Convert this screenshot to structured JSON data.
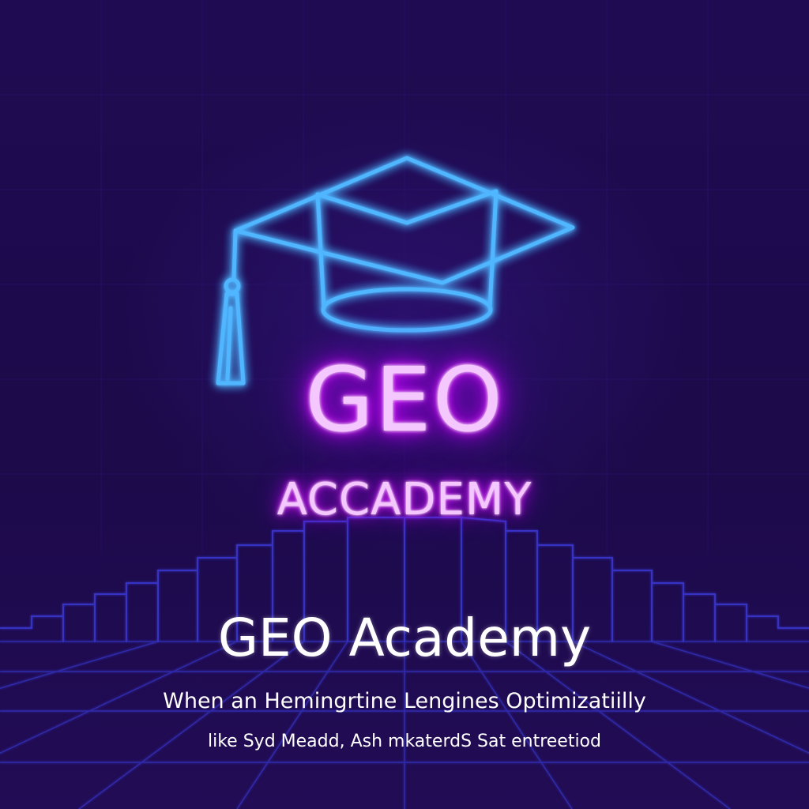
{
  "neon_sign": {
    "line1": "GEO",
    "line2": "ACCADEMY"
  },
  "title": "GEO Academy",
  "tagline": {
    "line1": "When an Hemingrtine Lengines Optimizatiilly",
    "line2": "like Syd Meadd, Ash mkaterdS Sat entreetiod"
  },
  "icons": {
    "cap": "graduation-cap-icon"
  },
  "colors": {
    "background": "#1e0a4e",
    "cap_neon": "#3aa8ff",
    "text_neon": "#e040fb",
    "grid": "#3b3bd8",
    "title_text": "#ffffff"
  }
}
